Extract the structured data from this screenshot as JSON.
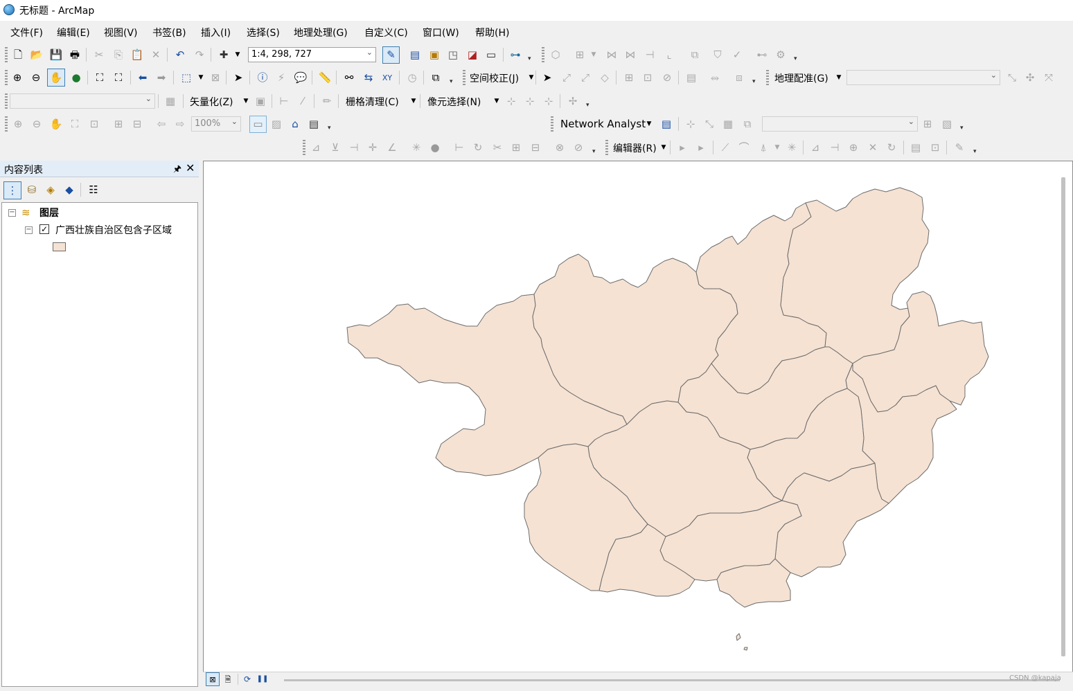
{
  "window": {
    "title": "无标题 - ArcMap"
  },
  "menu": [
    "文件(F)",
    "编辑(E)",
    "视图(V)",
    "书签(B)",
    "插入(I)",
    "选择(S)",
    "地理处理(G)",
    "自定义(C)",
    "窗口(W)",
    "帮助(H)"
  ],
  "toolbars": {
    "scale": "1:4, 298, 727",
    "spatial_adjustment": "空间校正(J)",
    "georeferencing": "地理配准(G)",
    "vectorization": "矢量化(Z)",
    "raster_cleanup": "栅格清理(C)",
    "cell_selection": "像元选择(N)",
    "zoom_percent": "100%",
    "network_analyst": "Network Analyst",
    "editor": "编辑器(R)"
  },
  "toc": {
    "title": "内容列表",
    "pin_glyph": "🖈",
    "close_glyph": "✕",
    "root_label": "图层",
    "layer_name": "广西壮族自治区包含子区域",
    "layer_checked": true,
    "fill_color": "#f5e2d3",
    "outline_color": "#6b6b6b"
  },
  "watermark": "CSDN @kapaja"
}
